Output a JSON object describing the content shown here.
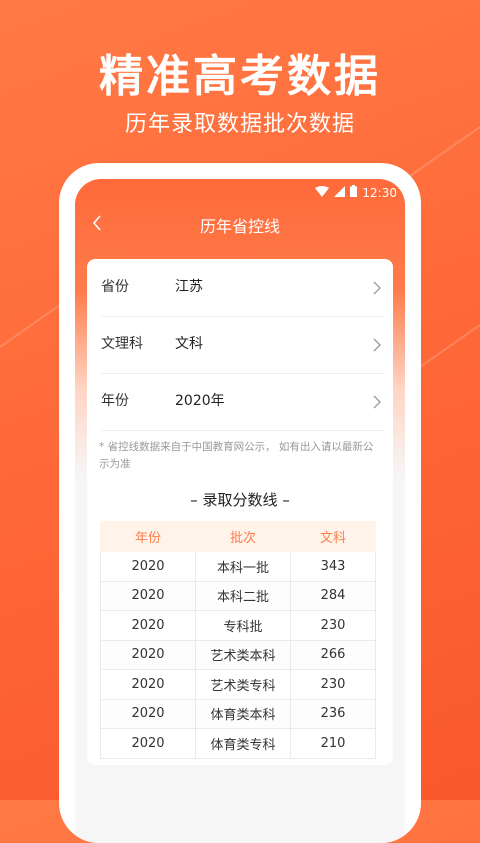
{
  "hero": {
    "title": "精准高考数据",
    "subtitle": "历年录取数据批次数据"
  },
  "status_bar": {
    "time": "12:30",
    "icons": [
      "wifi-icon",
      "signal-icon",
      "battery-icon"
    ]
  },
  "nav": {
    "back_icon": "chevron-left-icon",
    "title": "历年省控线"
  },
  "filters": [
    {
      "label": "省份",
      "value": "江苏"
    },
    {
      "label": "文理科",
      "value": "文科"
    },
    {
      "label": "年份",
      "value": "2020年"
    }
  ],
  "note": "* 省控线数据来自于中国教育网公示， 如有出入请以最新公示为准",
  "section_title": "– 录取分数线 –",
  "table": {
    "headers": [
      "年份",
      "批次",
      "文科"
    ],
    "rows": [
      [
        "2020",
        "本科一批",
        "343"
      ],
      [
        "2020",
        "本科二批",
        "284"
      ],
      [
        "2020",
        "专科批",
        "230"
      ],
      [
        "2020",
        "艺术类本科",
        "266"
      ],
      [
        "2020",
        "艺术类专科",
        "230"
      ],
      [
        "2020",
        "体育类本科",
        "236"
      ],
      [
        "2020",
        "体育类专科",
        "210"
      ]
    ]
  },
  "colors": {
    "brand": "#ff6a3a",
    "table_header_bg": "#fff3ea",
    "table_header_text": "#ff7c45"
  }
}
